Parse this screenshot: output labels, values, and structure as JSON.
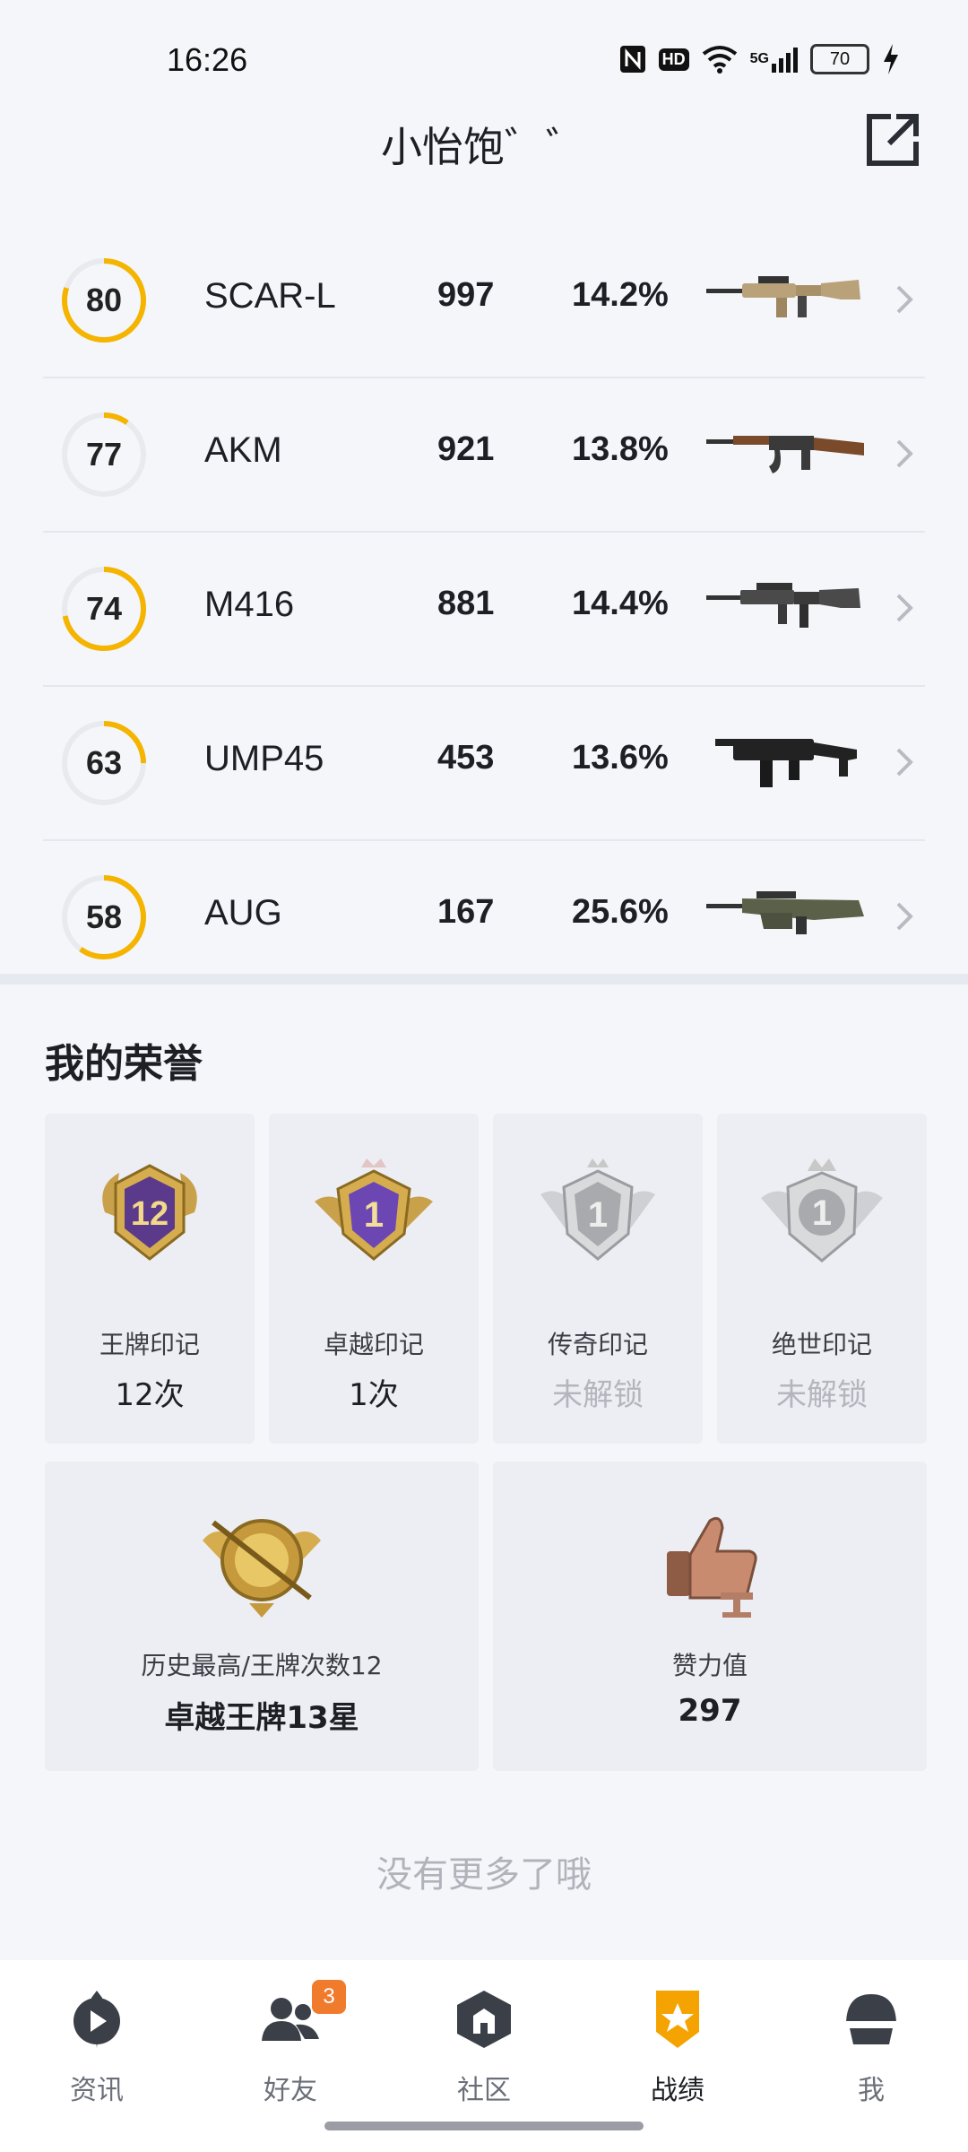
{
  "status_bar": {
    "time": "16:26",
    "icons": [
      "nfc-icon",
      "hd-icon",
      "wifi-icon",
      "5g-signal-icon",
      "battery-icon",
      "charging-icon"
    ],
    "hd_label": "HD",
    "network_label": "5G",
    "battery": "70"
  },
  "header": {
    "title": "小怡饱゛゛",
    "share_icon": "share-external-icon"
  },
  "weapons": [
    {
      "score": "80",
      "score_fraction": 0.8,
      "name": "SCAR-L",
      "count": "997",
      "percent": "14.2%"
    },
    {
      "score": "77",
      "score_fraction": 0.1,
      "name": "AKM",
      "count": "921",
      "percent": "13.8%"
    },
    {
      "score": "74",
      "score_fraction": 0.72,
      "name": "M416",
      "count": "881",
      "percent": "14.4%"
    },
    {
      "score": "63",
      "score_fraction": 0.25,
      "name": "UMP45",
      "count": "453",
      "percent": "13.6%"
    },
    {
      "score": "58",
      "score_fraction": 0.6,
      "name": "AUG",
      "count": "167",
      "percent": "25.6%"
    }
  ],
  "colors": {
    "ring_active": "#f5b400",
    "ring_track": "#e8eaee",
    "badge": "#f07b2d",
    "nav_active": "#f5a300"
  },
  "honor": {
    "title": "我的荣誉",
    "cards": [
      {
        "label": "王牌印记",
        "value": "12次",
        "emblem_number": "12",
        "locked": false
      },
      {
        "label": "卓越印记",
        "value": "1次",
        "emblem_number": "1",
        "locked": false
      },
      {
        "label": "传奇印记",
        "value": "未解锁",
        "emblem_number": "1",
        "locked": true
      },
      {
        "label": "绝世印记",
        "value": "未解锁",
        "emblem_number": "1",
        "locked": true
      }
    ],
    "wide_cards": [
      {
        "label": "历史最高/王牌次数12",
        "value": "卓越王牌13星"
      },
      {
        "label": "赞力值",
        "value": "297"
      }
    ]
  },
  "no_more": "没有更多了哦",
  "nav": [
    {
      "label": "资讯",
      "icon": "news-play-icon"
    },
    {
      "label": "好友",
      "icon": "friends-icon",
      "badge": "3"
    },
    {
      "label": "社区",
      "icon": "community-icon"
    },
    {
      "label": "战绩",
      "icon": "record-badge-icon",
      "active": true
    },
    {
      "label": "我",
      "icon": "helmet-icon"
    }
  ]
}
